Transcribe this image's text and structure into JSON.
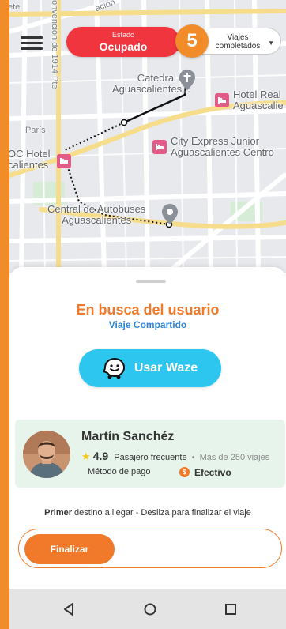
{
  "map": {
    "labels": {
      "top_left_street": "ete",
      "vertical_street": "onvención de 1914 Pte",
      "top_street": "ación",
      "partial_top_right": "A",
      "cathedral": "Catedral de\nAguascalientes...",
      "hotel_real": "Hotel Real\nAguascalie",
      "paris": "París",
      "city_express": "City Express Junior\nAguascalientes Centro",
      "oc_hotel": "OC Hotel\ncalientes",
      "central": "Central de Autobuses\nAguascalientes"
    }
  },
  "header": {
    "status_label": "Estado",
    "status_value": "Ocupado",
    "trips_count": "5",
    "trips_label": "Viajes completados"
  },
  "sheet": {
    "title": "En busca del usuario",
    "subtitle": "Viaje Compartido",
    "waze_button": "Usar Waze",
    "driver": {
      "name": "Martín Sanchéz",
      "rating": "4.9",
      "tier": "Pasajero frecuente",
      "trips": "Más de 250 viajes",
      "payment_label": "Método de pago",
      "payment_method": "Efectivo"
    },
    "hint_bold": "Primer",
    "hint_rest": " destino a llegar - Desliza para finalizar el viaje",
    "slider_label": "Finalizar"
  },
  "colors": {
    "accent": "#f07a2a",
    "status_busy": "#f0353f",
    "waze": "#2dc6ef",
    "card_bg": "#e7f4ec",
    "link_blue": "#2f86d6"
  }
}
